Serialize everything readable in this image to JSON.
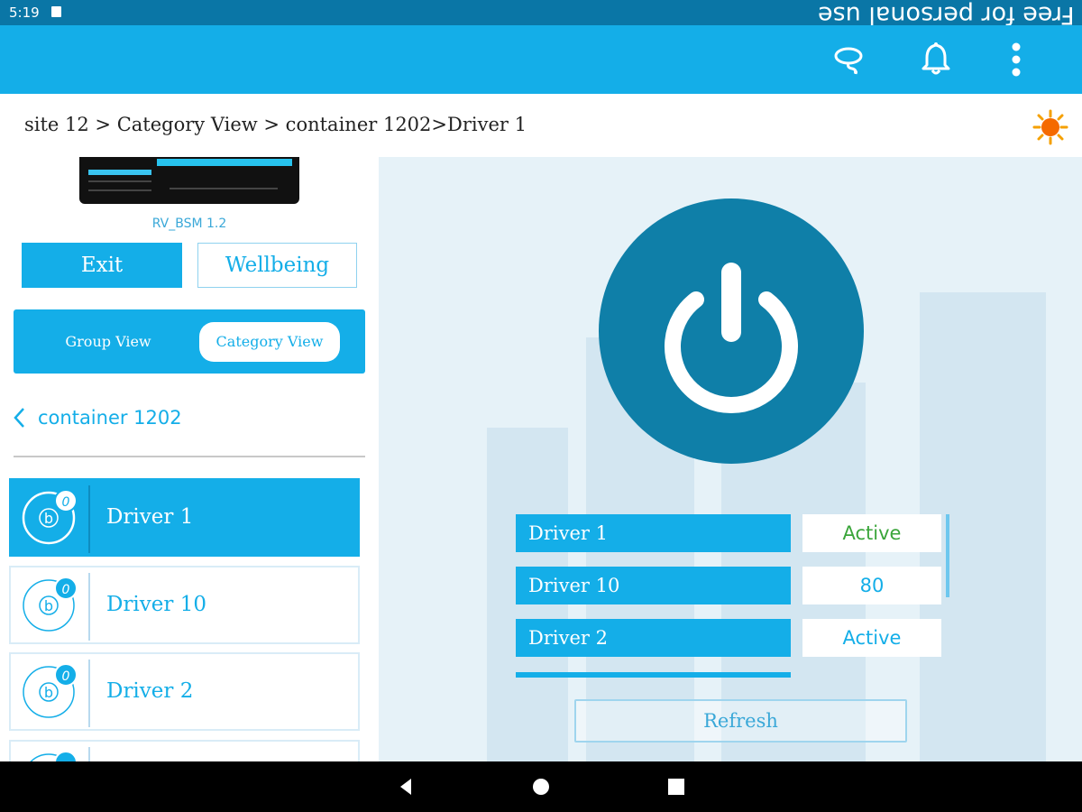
{
  "status_bar": {
    "time": "5:19",
    "watermark": "Free for personal use"
  },
  "app_bar": {
    "icons": [
      "lasso-icon",
      "bell-icon",
      "overflow-menu-icon"
    ]
  },
  "breadcrumb": {
    "text": "site 12 > Category View > container 1202>Driver 1"
  },
  "weather_icon": "sun-icon",
  "sidebar": {
    "device_name": "RV_BSM 1.2",
    "exit_label": "Exit",
    "wellbeing_label": "Wellbeing",
    "view_toggle": {
      "group_label": "Group View",
      "category_label": "Category View",
      "selected": "Category View"
    },
    "back_label": "container 1202",
    "drivers": [
      {
        "label": "Driver 1",
        "badge": "0",
        "active": true
      },
      {
        "label": "Driver 10",
        "badge": "0",
        "active": false
      },
      {
        "label": "Driver 2",
        "badge": "0",
        "active": false
      }
    ]
  },
  "main": {
    "power_icon": "power-icon",
    "table": [
      {
        "name": "Driver 1",
        "value": "Active"
      },
      {
        "name": "Driver 10",
        "value": "80"
      },
      {
        "name": "Driver 2",
        "value": "Active"
      }
    ],
    "refresh_label": "Refresh"
  },
  "colors": {
    "primary": "#14aee8",
    "status_bar": "#0a76a6",
    "power_button": "#0f7fa8",
    "active_green": "#3aa53a"
  },
  "nav_bar": {
    "icons": [
      "back-icon",
      "home-icon",
      "recents-icon"
    ]
  }
}
